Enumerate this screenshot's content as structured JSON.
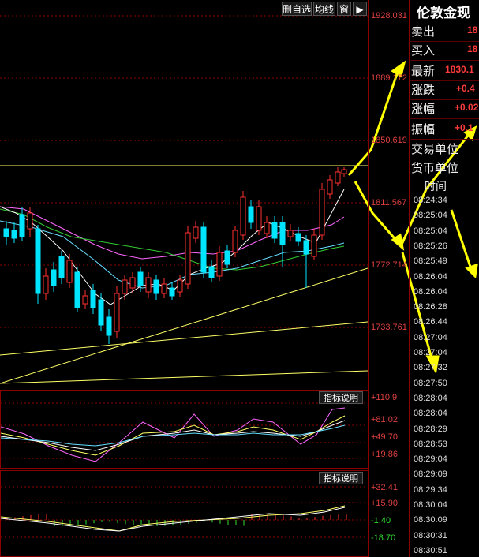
{
  "toolbar": {
    "buttons": [
      "删自选",
      "均线",
      "窗"
    ],
    "arrow_icon": "arrow-right-icon"
  },
  "quote": {
    "title": "伦敦金现",
    "rows": [
      {
        "label": "卖出",
        "value": "18"
      },
      {
        "label": "买入",
        "value": "18"
      },
      {
        "label": "最新",
        "value": "1830.1"
      },
      {
        "label": "涨跌",
        "value": "+0.4"
      },
      {
        "label": "涨幅",
        "value": "+0.02"
      },
      {
        "label": "振幅",
        "value": "+0.1"
      }
    ],
    "info_labels": [
      "交易单位",
      "货币单位"
    ],
    "time_header": "时间",
    "ticks": [
      "08:24:34",
      "08:25:04",
      "08:25:04",
      "08:25:26",
      "08:25:49",
      "08:26:04",
      "08:26:04",
      "08:26:28",
      "08:26:44",
      "08:27:04",
      "08:27:04",
      "08:27:32",
      "08:27:50",
      "08:28:04",
      "08:28:04",
      "08:28:29",
      "08:28:53",
      "08:29:04",
      "08:29:09",
      "08:29:34",
      "08:30:04",
      "08:30:09",
      "08:30:31",
      "08:30:51"
    ]
  },
  "price_axis": [
    "1928.031",
    "1889.172",
    "1850.619",
    "1811.567",
    "1772.714",
    "1733.761"
  ],
  "indicator1": {
    "button": "指标说明",
    "levels": [
      "+110.9",
      "+81.02",
      "+49.70",
      "+19.86"
    ]
  },
  "indicator2": {
    "button": "指标说明",
    "levels": [
      "+32.41",
      "+15.90",
      "-1.40",
      "-18.70"
    ]
  },
  "colors": {
    "up": "#ff3030",
    "down": "#00e5ff",
    "grid": "#8b0000",
    "annotation": "#ffff00"
  }
}
